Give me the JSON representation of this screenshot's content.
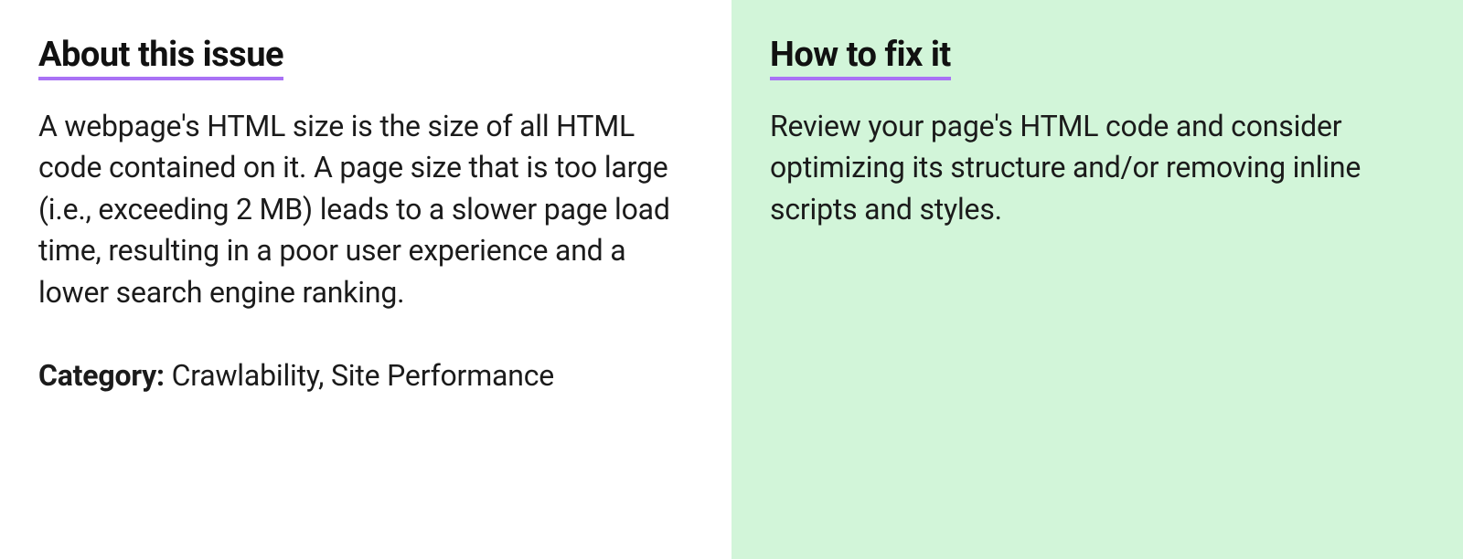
{
  "left": {
    "heading": "About this issue",
    "description": "A webpage's HTML size is the size of all HTML code contained on it. A page size that is too large (i.e., exceeding 2 MB) leads to a slower page load time, resulting in a poor user experience and a lower search engine ranking.",
    "category_label": "Category: ",
    "category_value": "Crawlability, Site Performance"
  },
  "right": {
    "heading": "How to fix it",
    "description": "Review your page's HTML code and consider optimizing its structure and/or removing inline scripts and styles."
  }
}
